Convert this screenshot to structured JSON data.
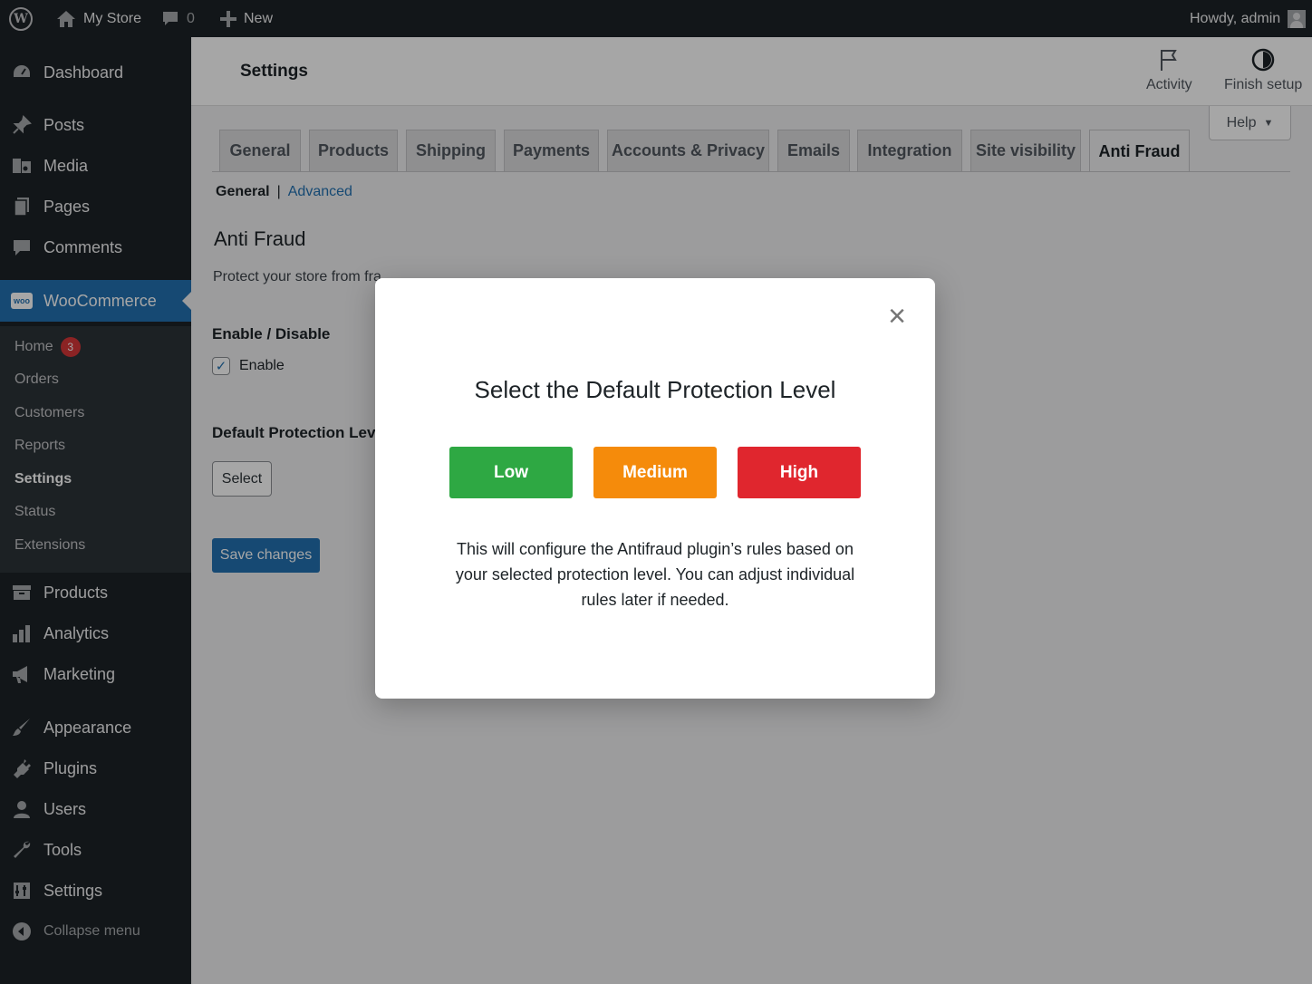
{
  "adminbar": {
    "site_name": "My Store",
    "comments_count": "0",
    "new_label": "New",
    "greeting": "Howdy, admin"
  },
  "sidebar": {
    "items_top": [
      {
        "label": "Dashboard",
        "icon": "dashboard-icon"
      },
      {
        "label": "Posts",
        "icon": "pin-icon"
      },
      {
        "label": "Media",
        "icon": "media-icon"
      },
      {
        "label": "Pages",
        "icon": "pages-icon"
      },
      {
        "label": "Comments",
        "icon": "comment-icon"
      }
    ],
    "woocommerce": {
      "label": "WooCommerce",
      "icon_text": "woo"
    },
    "submenu": [
      {
        "label": "Home",
        "badge": "3"
      },
      {
        "label": "Orders"
      },
      {
        "label": "Customers"
      },
      {
        "label": "Reports"
      },
      {
        "label": "Settings"
      },
      {
        "label": "Status"
      },
      {
        "label": "Extensions"
      }
    ],
    "items_bottom": [
      {
        "label": "Products",
        "icon": "archive-icon"
      },
      {
        "label": "Analytics",
        "icon": "bar-chart-icon"
      },
      {
        "label": "Marketing",
        "icon": "megaphone-icon"
      },
      {
        "label": "Appearance",
        "icon": "brush-icon"
      },
      {
        "label": "Plugins",
        "icon": "plug-icon"
      },
      {
        "label": "Users",
        "icon": "user-icon"
      },
      {
        "label": "Tools",
        "icon": "wrench-icon"
      },
      {
        "label": "Settings",
        "icon": "settings-icon"
      },
      {
        "label": "Collapse menu",
        "icon": "collapse-icon"
      }
    ]
  },
  "header": {
    "title": "Settings",
    "activity_label": "Activity",
    "finish_setup_label": "Finish setup",
    "help_label": "Help"
  },
  "tabs": [
    "General",
    "Products",
    "Shipping",
    "Payments",
    "Accounts & Privacy",
    "Emails",
    "Integration",
    "Site visibility",
    "Anti Fraud"
  ],
  "active_tab": "Anti Fraud",
  "subsections": {
    "current": "General",
    "separator": "|",
    "other": "Advanced"
  },
  "content": {
    "section_title": "Anti Fraud",
    "description": "Protect your store from fra",
    "enable_label": "Enable / Disable",
    "enable_checkbox_label": "Enable",
    "enable_checked": true,
    "protection_label": "Default Protection Level",
    "select_label": "Select",
    "save_label": "Save changes"
  },
  "modal": {
    "title": "Select the Default Protection Level",
    "close_symbol": "×",
    "levels": [
      {
        "label": "Low",
        "color": "#2ea843"
      },
      {
        "label": "Medium",
        "color": "#f58b0b"
      },
      {
        "label": "High",
        "color": "#e0262e"
      }
    ],
    "description": "This will configure the Antifraud plugin’s rules based on your selected protection level. You can adjust individual rules later if needed."
  },
  "colors": {
    "admin_dark": "#1d2327",
    "accent": "#2271b1",
    "badge": "#d63638"
  }
}
